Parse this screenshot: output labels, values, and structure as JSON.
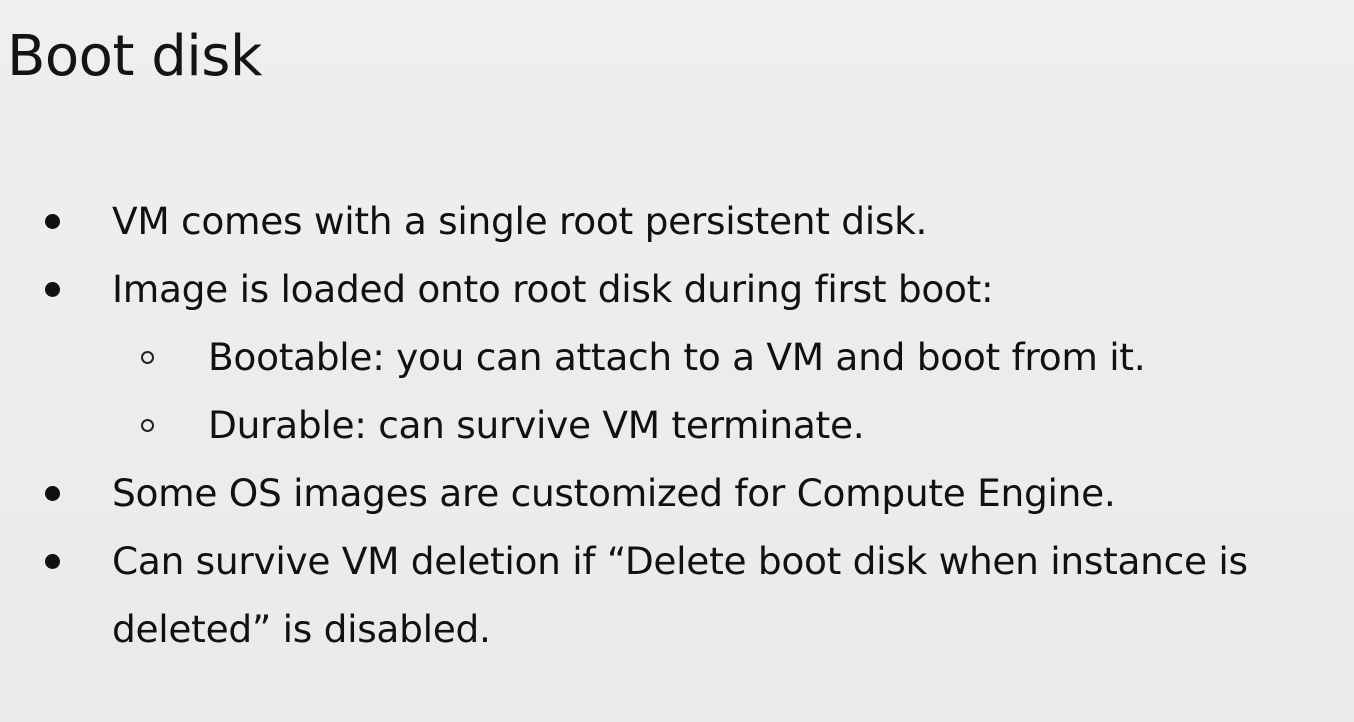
{
  "slide": {
    "title": "Boot disk",
    "bullets": [
      {
        "level": 1,
        "text": "VM comes with a single root persistent disk."
      },
      {
        "level": 1,
        "text": "Image is loaded onto root disk during first boot:"
      },
      {
        "level": 2,
        "text": "Bootable: you can attach to a VM and boot from it."
      },
      {
        "level": 2,
        "text": "Durable: can survive VM terminate."
      },
      {
        "level": 1,
        "text": "Some OS images are customized for Compute Engine."
      },
      {
        "level": 1,
        "text": "Can survive VM deletion if “Delete boot disk when instance is"
      },
      {
        "level": 1,
        "text": "deleted” is disabled.",
        "continuation": true
      }
    ]
  }
}
